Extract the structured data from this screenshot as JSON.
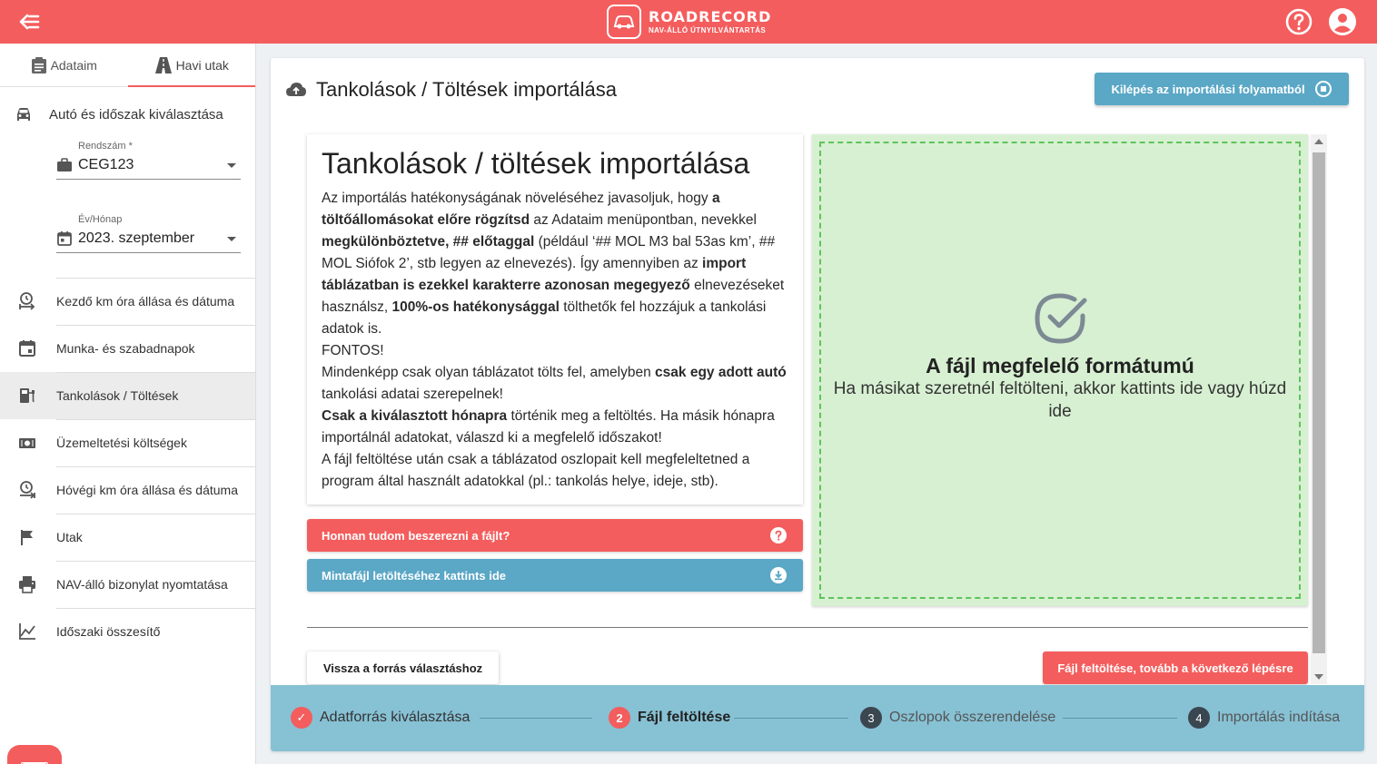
{
  "brand": {
    "name": "ROADRECORD",
    "tagline": "NAV-ÁLLÓ ÚTNYILVÁNTARTÁS",
    "color": "#f45d5d"
  },
  "sidebar": {
    "tabs": [
      {
        "label": "Adataim",
        "icon": "clipboard-icon"
      },
      {
        "label": "Havi utak",
        "icon": "road-icon",
        "active": true
      }
    ],
    "car_section": "Autó és időszak kiválasztása",
    "plate_field": {
      "label": "Rendszám *",
      "value": "CEG123"
    },
    "period_field": {
      "label": "Év/Hónap",
      "value": "2023. szeptember"
    },
    "items": [
      {
        "label": "Kezdő km óra állása és dátuma",
        "icon": "clock-arrow-icon"
      },
      {
        "label": "Munka- és szabadnapok",
        "icon": "calendar-icon"
      },
      {
        "label": "Tankolások / Töltések",
        "icon": "fuel-pump-icon",
        "active": true
      },
      {
        "label": "Üzemeltetési költségek",
        "icon": "money-icon"
      },
      {
        "label": "Hóvégi km óra állása és dátuma",
        "icon": "clock-arrow-icon"
      },
      {
        "label": "Utak",
        "icon": "flag-icon"
      },
      {
        "label": "NAV-álló bizonylat nyomtatása",
        "icon": "printer-icon"
      },
      {
        "label": "Időszaki összesítő",
        "icon": "chart-line-icon"
      }
    ]
  },
  "main": {
    "title": "Tankolások / Töltések importálása",
    "exit_button": "Kilépés az importálási folyamatból",
    "info": {
      "heading": "Tankolások / töltések importálása",
      "p1_a": "Az importálás hatékonyságának növeléséhez javasoljuk, hogy ",
      "p1_b": "a töltőállomásokat előre rögzítsd",
      "p1_c": " az Adataim menüpontban, nevekkel ",
      "p1_d": "megkülönböztetve, ## előtaggal",
      "p1_e": " (például ‘## MOL M3 bal 53as km’, ## MOL Siófok 2’, stb legyen az elnevezés). Így amennyiben az ",
      "p1_f": "import táblázatban is ezekkel karakterre azonosan megegyező",
      "p1_g": " elnevezéseket használsz, ",
      "p1_h": "100%-os hatékonysággal",
      "p1_i": " tölthetők fel hozzájuk a tankolási adatok is.",
      "p2": "FONTOS!",
      "p3_a": "Mindenképp csak olyan táblázatot tölts fel, amelyben ",
      "p3_b": "csak egy adott autó",
      "p3_c": " tankolási adatai szerepelnek!",
      "p4_a": "Csak a kiválasztott hónapra",
      "p4_b": " történik meg a feltöltés. Ha másik hónapra importálnál adatokat, válaszd ki a megfelelő időszakot!",
      "p5": "A fájl feltöltése után csak a táblázatod oszlopait kell megfeleltetned a program által használt adatokkal (pl.: tankolás helye, ideje, stb)."
    },
    "help_bar": "Honnan tudom beszerezni a fájlt?",
    "sample_bar": "Mintafájl letöltéséhez kattints ide",
    "dropzone": {
      "title": "A fájl megfelelő formátumú",
      "subtitle": "Ha másikat szeretnél feltölteni, akkor kattints ide vagy húzd ide"
    },
    "back_button": "Vissza a forrás választáshoz",
    "next_button": "Fájl feltöltése, tovább a következő lépésre"
  },
  "steps": [
    {
      "num": "✓",
      "label": "Adatforrás kiválasztása",
      "state": "done"
    },
    {
      "num": "2",
      "label": "Fájl feltöltése",
      "state": "current"
    },
    {
      "num": "3",
      "label": "Oszlopok összerendelése",
      "state": "pending"
    },
    {
      "num": "4",
      "label": "Importálás indítása",
      "state": "pending"
    }
  ]
}
